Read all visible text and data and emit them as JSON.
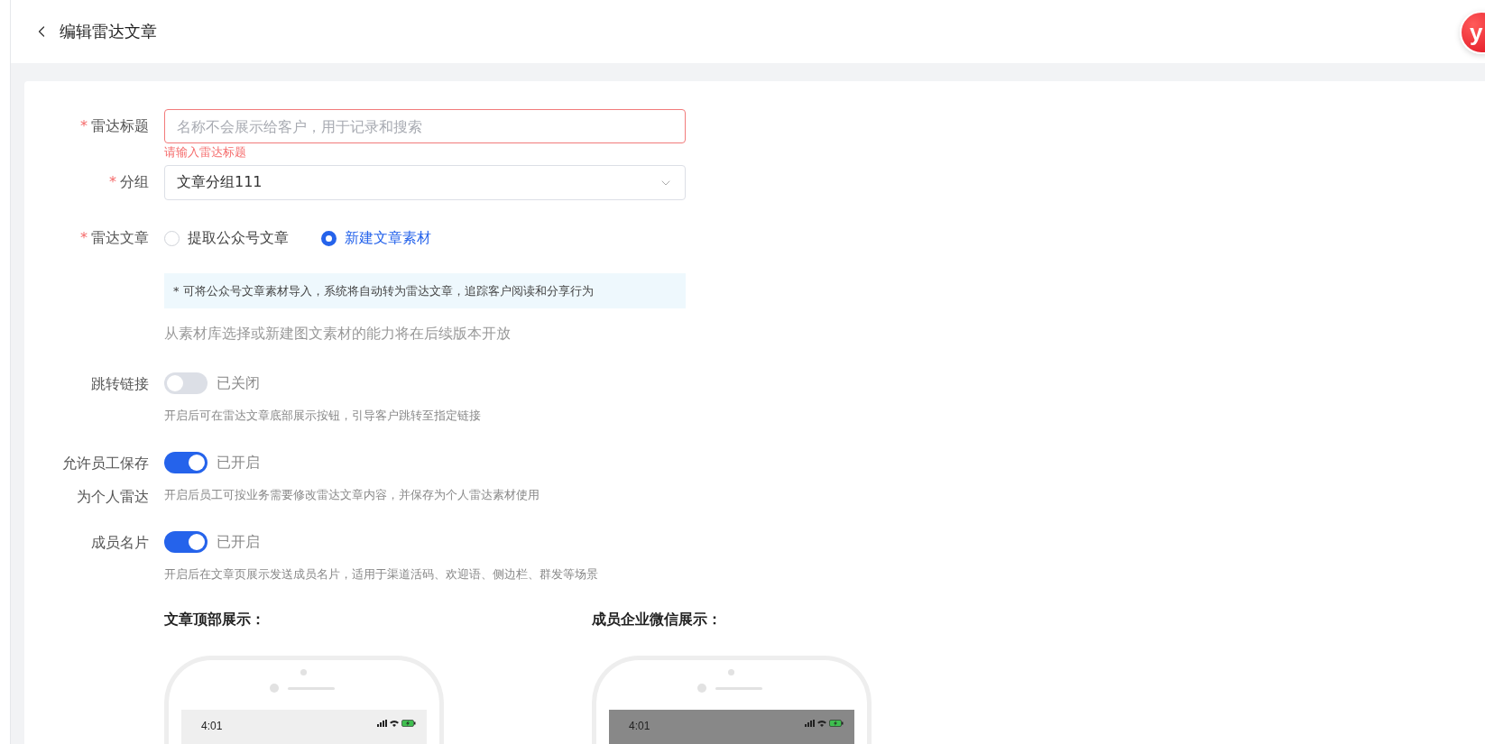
{
  "header": {
    "title": "编辑雷达文章"
  },
  "logo": {
    "text": "y"
  },
  "title_field": {
    "required_mark": "*",
    "label": "雷达标题",
    "placeholder": "名称不会展示给客户，用于记录和搜索",
    "error": "请输入雷达标题"
  },
  "group_field": {
    "required_mark": "*",
    "label": "分组",
    "value": "文章分组111"
  },
  "article_field": {
    "required_mark": "*",
    "label": "雷达文章",
    "options": [
      {
        "label": "提取公众号文章",
        "selected": false
      },
      {
        "label": "新建文章素材",
        "selected": true
      }
    ],
    "notice": "* 可将公众号文章素材导入，系统将自动转为雷达文章，追踪客户阅读和分享行为",
    "note": "从素材库选择或新建图文素材的能力将在后续版本开放"
  },
  "toggles": [
    {
      "label": "跳转链接",
      "on": false,
      "state_text": "已关闭",
      "hint": "开启后可在雷达文章底部展示按钮，引导客户跳转至指定链接"
    },
    {
      "label": "允许员工保存为个人雷达",
      "on": true,
      "state_text": "已开启",
      "hint": "开启后员工可按业务需要修改雷达文章内容，并保存为个人雷达素材使用"
    },
    {
      "label": "成员名片",
      "on": true,
      "state_text": "已开启",
      "hint": "开启后在文章页展示发送成员名片，适用于渠道活码、欢迎语、侧边栏、群发等场景"
    }
  ],
  "previews": [
    {
      "title": "文章顶部展示：",
      "kind": "light",
      "time": "4:01"
    },
    {
      "title": "成员企业微信展示：",
      "kind": "dark",
      "time": "4:01"
    }
  ]
}
